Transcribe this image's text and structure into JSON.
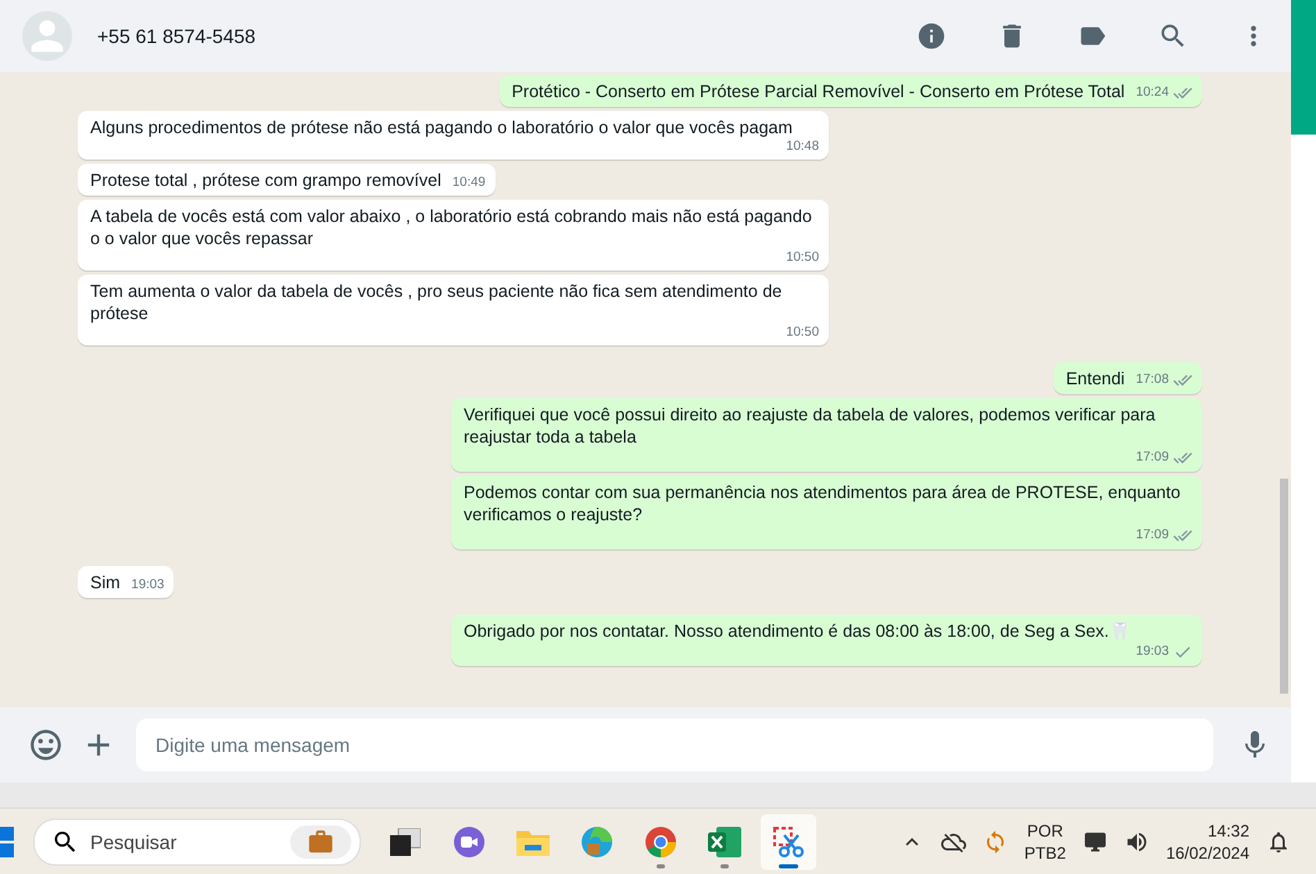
{
  "header": {
    "contact": "+55 61 8574-5458"
  },
  "messages": [
    {
      "kind": "outgoing",
      "text": "Protético - Conserto em Prótese Parcial Removível - Conserto em Prótese Total",
      "time": "10:24",
      "double_tick": true
    },
    {
      "kind": "incoming",
      "text": "Alguns procedimentos de prótese não está pagando o laboratório o valor que vocês pagam",
      "time": "10:48"
    },
    {
      "kind": "incoming",
      "text": "Protese total , prótese com grampo removível",
      "time": "10:49"
    },
    {
      "kind": "incoming",
      "text": "A tabela de vocês está com valor abaixo , o laboratório está cobrando mais não está pagando o o valor que vocês repassar",
      "time": "10:50"
    },
    {
      "kind": "incoming",
      "text": "Tem aumenta o valor da tabela de vocês , pro seus paciente não fica sem atendimento de prótese",
      "time": "10:50"
    },
    {
      "kind": "outgoing",
      "text": "Entendi",
      "time": "17:08",
      "double_tick": true
    },
    {
      "kind": "outgoing",
      "text": "Verifiquei que você possui direito ao reajuste da tabela de valores, podemos verificar para reajustar toda a tabela",
      "time": "17:09",
      "double_tick": true
    },
    {
      "kind": "outgoing",
      "text": "Podemos contar com sua permanência nos atendimentos para área de PROTESE, enquanto verificamos o reajuste?",
      "time": "17:09",
      "double_tick": true
    },
    {
      "kind": "incoming",
      "text": "Sim",
      "time": "19:03"
    },
    {
      "kind": "outgoing",
      "text": "Obrigado por nos contatar. Nosso atendimento é das 08:00 às 18:00, de Seg a Sex.🦷",
      "time": "19:03",
      "double_tick": false
    }
  ],
  "composer": {
    "placeholder": "Digite uma mensagem"
  },
  "taskbar": {
    "search_placeholder": "Pesquisar",
    "apps": [
      {
        "kind": "taskview",
        "running": false,
        "selected": false
      },
      {
        "kind": "teams",
        "running": false,
        "selected": false
      },
      {
        "kind": "files",
        "running": false,
        "selected": false
      },
      {
        "kind": "edge",
        "running": false,
        "selected": false
      },
      {
        "kind": "chrome",
        "running": true,
        "selected": false
      },
      {
        "kind": "excel",
        "running": true,
        "selected": false
      },
      {
        "kind": "snip",
        "running": true,
        "selected": true
      }
    ],
    "language": "POR",
    "layout": "PTB2",
    "time": "14:32",
    "date": "16/02/2024"
  }
}
